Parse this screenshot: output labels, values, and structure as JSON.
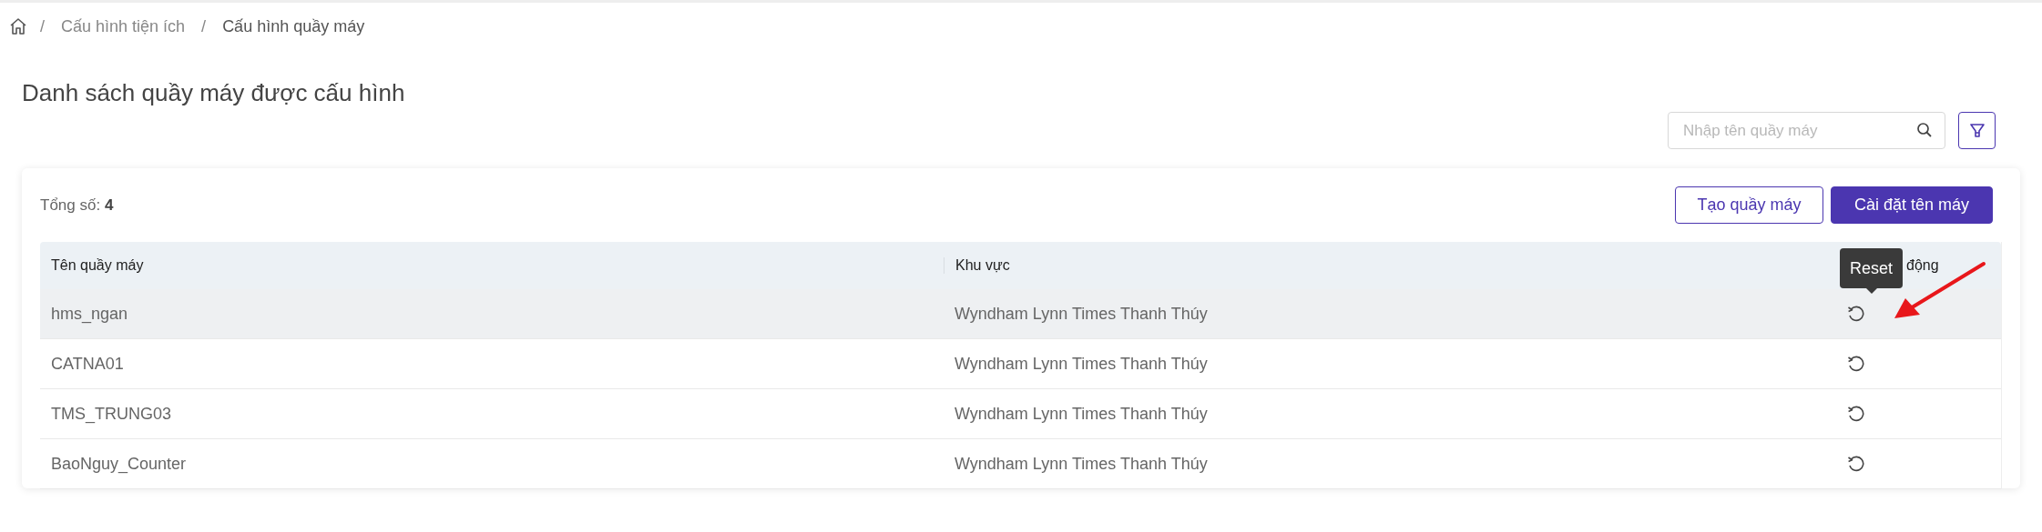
{
  "breadcrumb": [
    {
      "separator": "/",
      "label": "Cấu hình tiện ích",
      "current": false
    },
    {
      "separator": "/",
      "label": "Cấu hình quầy máy",
      "current": true
    }
  ],
  "page_title": "Danh sách quầy máy được cấu hình",
  "search": {
    "placeholder": "Nhập tên quầy máy"
  },
  "total": {
    "label": "Tổng số:",
    "value": "4"
  },
  "buttons": [
    {
      "label": "Tạo quầy máy",
      "kind": "outline"
    },
    {
      "label": "Cài đặt tên máy",
      "kind": "primary"
    }
  ],
  "table": {
    "columns": [
      "Tên quầy máy",
      "Khu vực",
      "động"
    ],
    "rows": [
      {
        "name": "hms_ngan",
        "area": "Wyndham Lynn Times Thanh Thúy",
        "highlighted": true
      },
      {
        "name": "CATNA01",
        "area": "Wyndham Lynn Times Thanh Thúy",
        "highlighted": false
      },
      {
        "name": "TMS_TRUNG03",
        "area": "Wyndham Lynn Times Thanh Thúy",
        "highlighted": false
      },
      {
        "name": "BaoNguy_Counter",
        "area": "Wyndham Lynn Times Thanh Thúy",
        "highlighted": false
      }
    ]
  },
  "tooltip": "Reset"
}
